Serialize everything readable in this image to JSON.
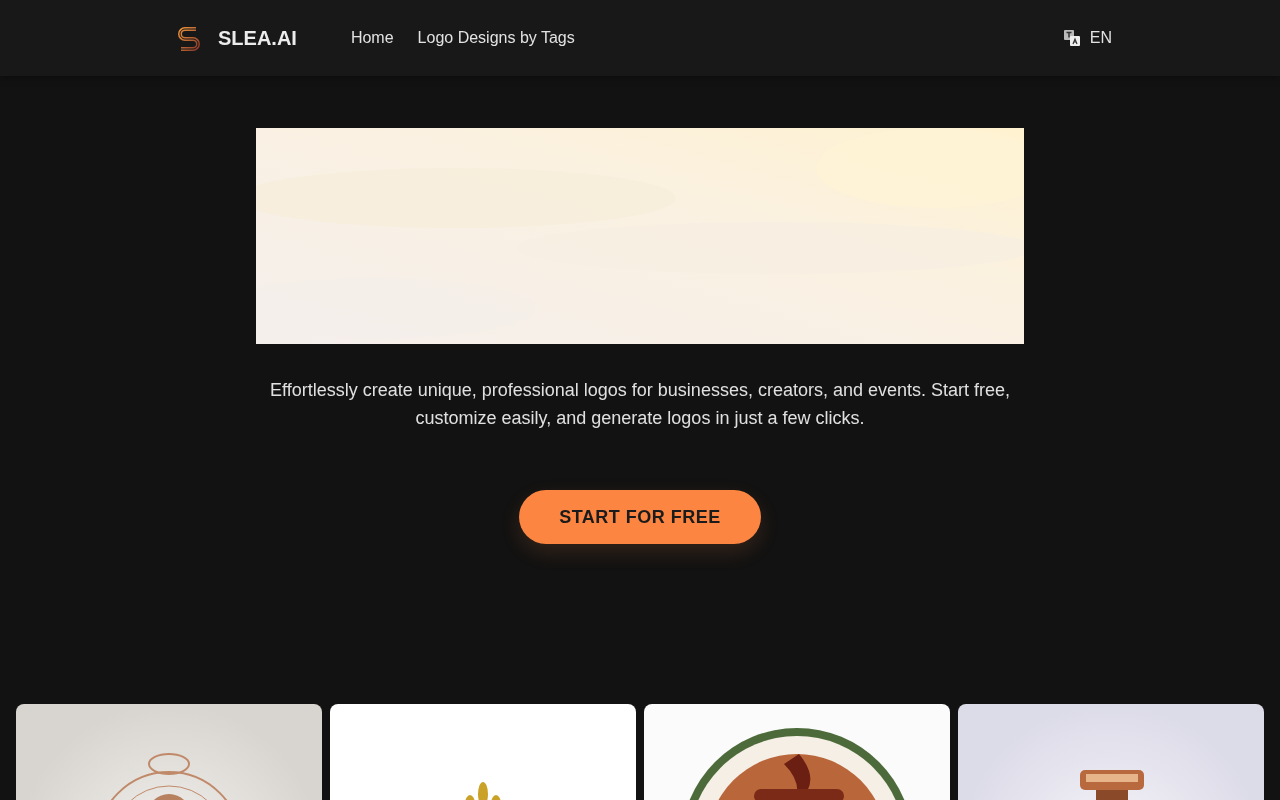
{
  "header": {
    "brand": "SLEA.AI",
    "nav": [
      {
        "label": "Home"
      },
      {
        "label": "Logo Designs by Tags"
      }
    ],
    "language": "EN"
  },
  "hero": {
    "description": "Effortlessly create unique, professional logos for businesses, creators, and events. Start free, customize easily, and generate logos in just a few clicks.",
    "cta": "START FOR FREE"
  },
  "gallery": [
    {
      "kind": "ornament"
    },
    {
      "kind": "leaf"
    },
    {
      "kind": "badge"
    },
    {
      "kind": "bottle"
    }
  ]
}
